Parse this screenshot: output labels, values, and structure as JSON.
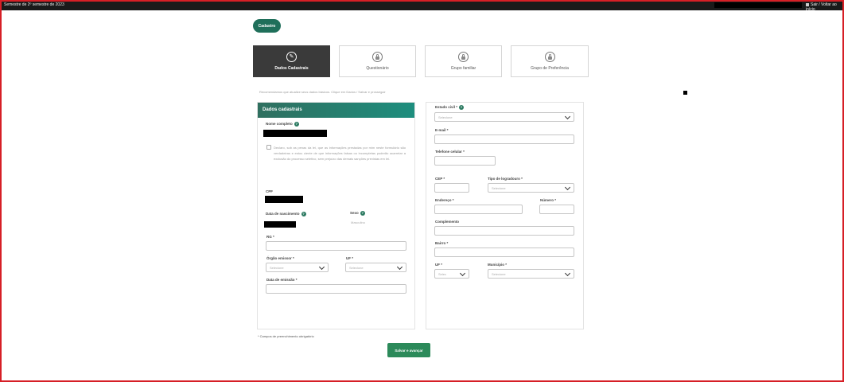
{
  "topbar": {
    "left_text": "Semestre de 2º semestre de 2023",
    "right_text": "Sair / Voltar ao início"
  },
  "header": {
    "pill_label": "Cadastro"
  },
  "steps": [
    {
      "label": "Dados Cadastrais",
      "icon": "pencil-icon",
      "active": true
    },
    {
      "label": "Questionário",
      "icon": "lock-icon",
      "active": false
    },
    {
      "label": "Grupo familiar",
      "icon": "lock-icon",
      "active": false
    },
    {
      "label": "Grupo de Preferência",
      "icon": "lock-icon",
      "active": false
    }
  ],
  "hint": "Recomendamos que atualize seus dados básicos. Clique em Dados / Salvar e prosseguir",
  "left_card": {
    "title": "Dados cadastrais",
    "full_name_label": "Nome completo",
    "disclaimer": "Declaro, sob as penas da lei, que as informações prestadas por mim neste formulário são verdadeiras e estou ciente de que informações falsas ou incompletas poderão acarretar a exclusão do processo seletivo, sem prejuízo das demais sanções previstas em lei.",
    "cpf_label": "CPF",
    "birth_label": "Data de nascimento",
    "sex_label": "Sexo",
    "sex_value": "Masculino",
    "rg_label": "RG *",
    "issuer_label": "Órgão emissor *",
    "issuer_placeholder": "Selecione",
    "uf_label": "UF *",
    "uf_placeholder": "Selecione",
    "issue_date_label": "Data de emissão *"
  },
  "right_card": {
    "marital_label": "Estado civil *",
    "marital_placeholder": "Selecione",
    "email_label": "E-mail *",
    "phone_label": "Telefone celular *",
    "cep_label": "CEP *",
    "street_type_label": "Tipo de logradouro *",
    "street_type_placeholder": "Selecione",
    "address_label": "Endereço *",
    "number_label": "Número *",
    "complement_label": "Complemento",
    "district_label": "Bairro *",
    "uf_label": "UF *",
    "uf_placeholder": "Selec",
    "city_label": "Município *",
    "city_placeholder": "Selecione"
  },
  "footnote": "* Campos de preenchimento obrigatório",
  "submit_label": "Salvar e avançar"
}
